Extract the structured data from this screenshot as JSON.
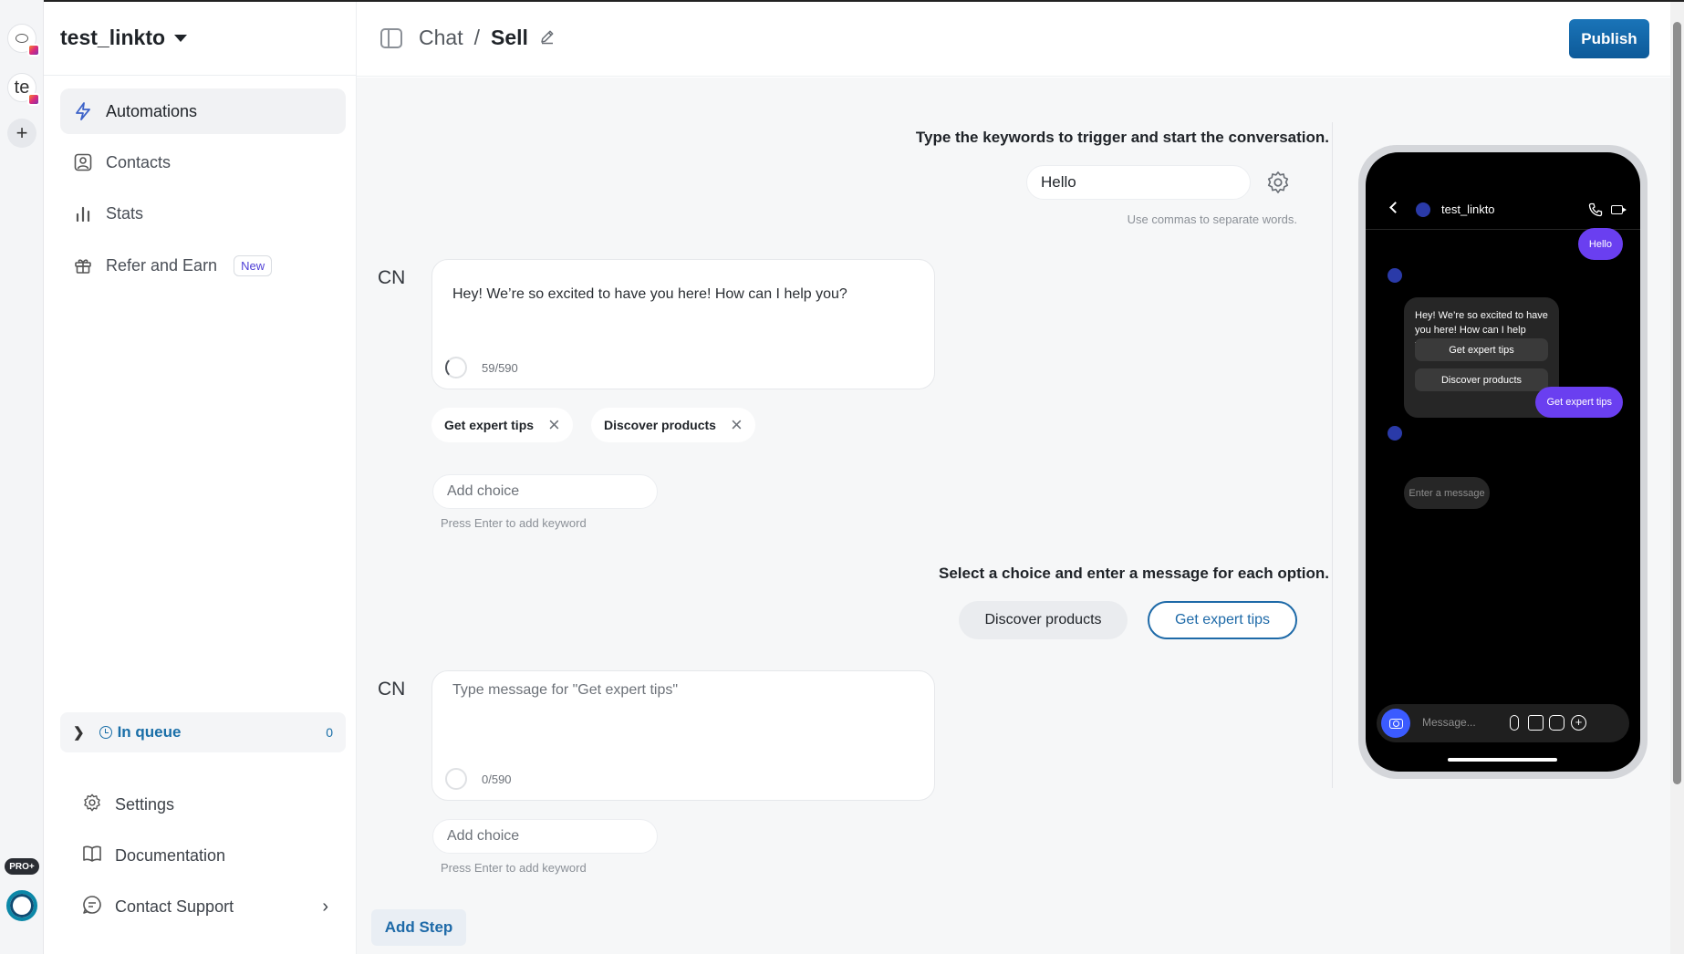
{
  "workspace": {
    "name": "test_linkto"
  },
  "rail": {
    "account_initials": "te",
    "add_label": "+",
    "plan_badge": "PRO+"
  },
  "sidebar": {
    "items": [
      {
        "label": "Automations"
      },
      {
        "label": "Contacts"
      },
      {
        "label": "Stats"
      },
      {
        "label": "Refer and Earn",
        "badge": "New"
      }
    ],
    "queue": {
      "label": "In queue",
      "count": "0"
    },
    "bottom": [
      {
        "label": "Settings"
      },
      {
        "label": "Documentation"
      },
      {
        "label": "Contact Support"
      }
    ]
  },
  "header": {
    "crumb_parent": "Chat",
    "crumb_sep": "/",
    "crumb_current": "Sell",
    "publish_label": "Publish"
  },
  "trigger": {
    "title": "Type the keywords to trigger and start the conversation.",
    "keyword_value": "Hello",
    "hint": "Use commas to separate words."
  },
  "step1": {
    "avatar": "CN",
    "message": "Hey! We’re so excited to have you here! How can I help you?",
    "char_count": "59/590",
    "choices": [
      "Get expert tips",
      "Discover products"
    ],
    "add_choice_placeholder": "Add choice",
    "add_choice_hint": "Press Enter to add keyword"
  },
  "select": {
    "title": "Select a choice and enter a message for each option.",
    "options": [
      "Discover products",
      "Get expert tips"
    ],
    "selected": "Get expert tips"
  },
  "step2": {
    "avatar": "CN",
    "placeholder": "Type message for \"Get expert tips\"",
    "char_count": "0/590",
    "add_choice_placeholder": "Add choice",
    "add_choice_hint": "Press Enter to add keyword"
  },
  "add_step_label": "Add Step",
  "phone": {
    "username": "test_linkto",
    "outgoing_1": "Hello",
    "incoming_text": "Hey! We’re so excited to have you here! How can I help you?",
    "quick_replies": [
      "Get expert tips",
      "Discover products"
    ],
    "outgoing_2": "Get expert tips",
    "incoming_placeholder": "Enter a message",
    "compose_placeholder": "Message..."
  },
  "colors": {
    "primary": "#1a6fa8",
    "publish": "#0d5a99",
    "phone_bubble": "#6a3ff0"
  }
}
